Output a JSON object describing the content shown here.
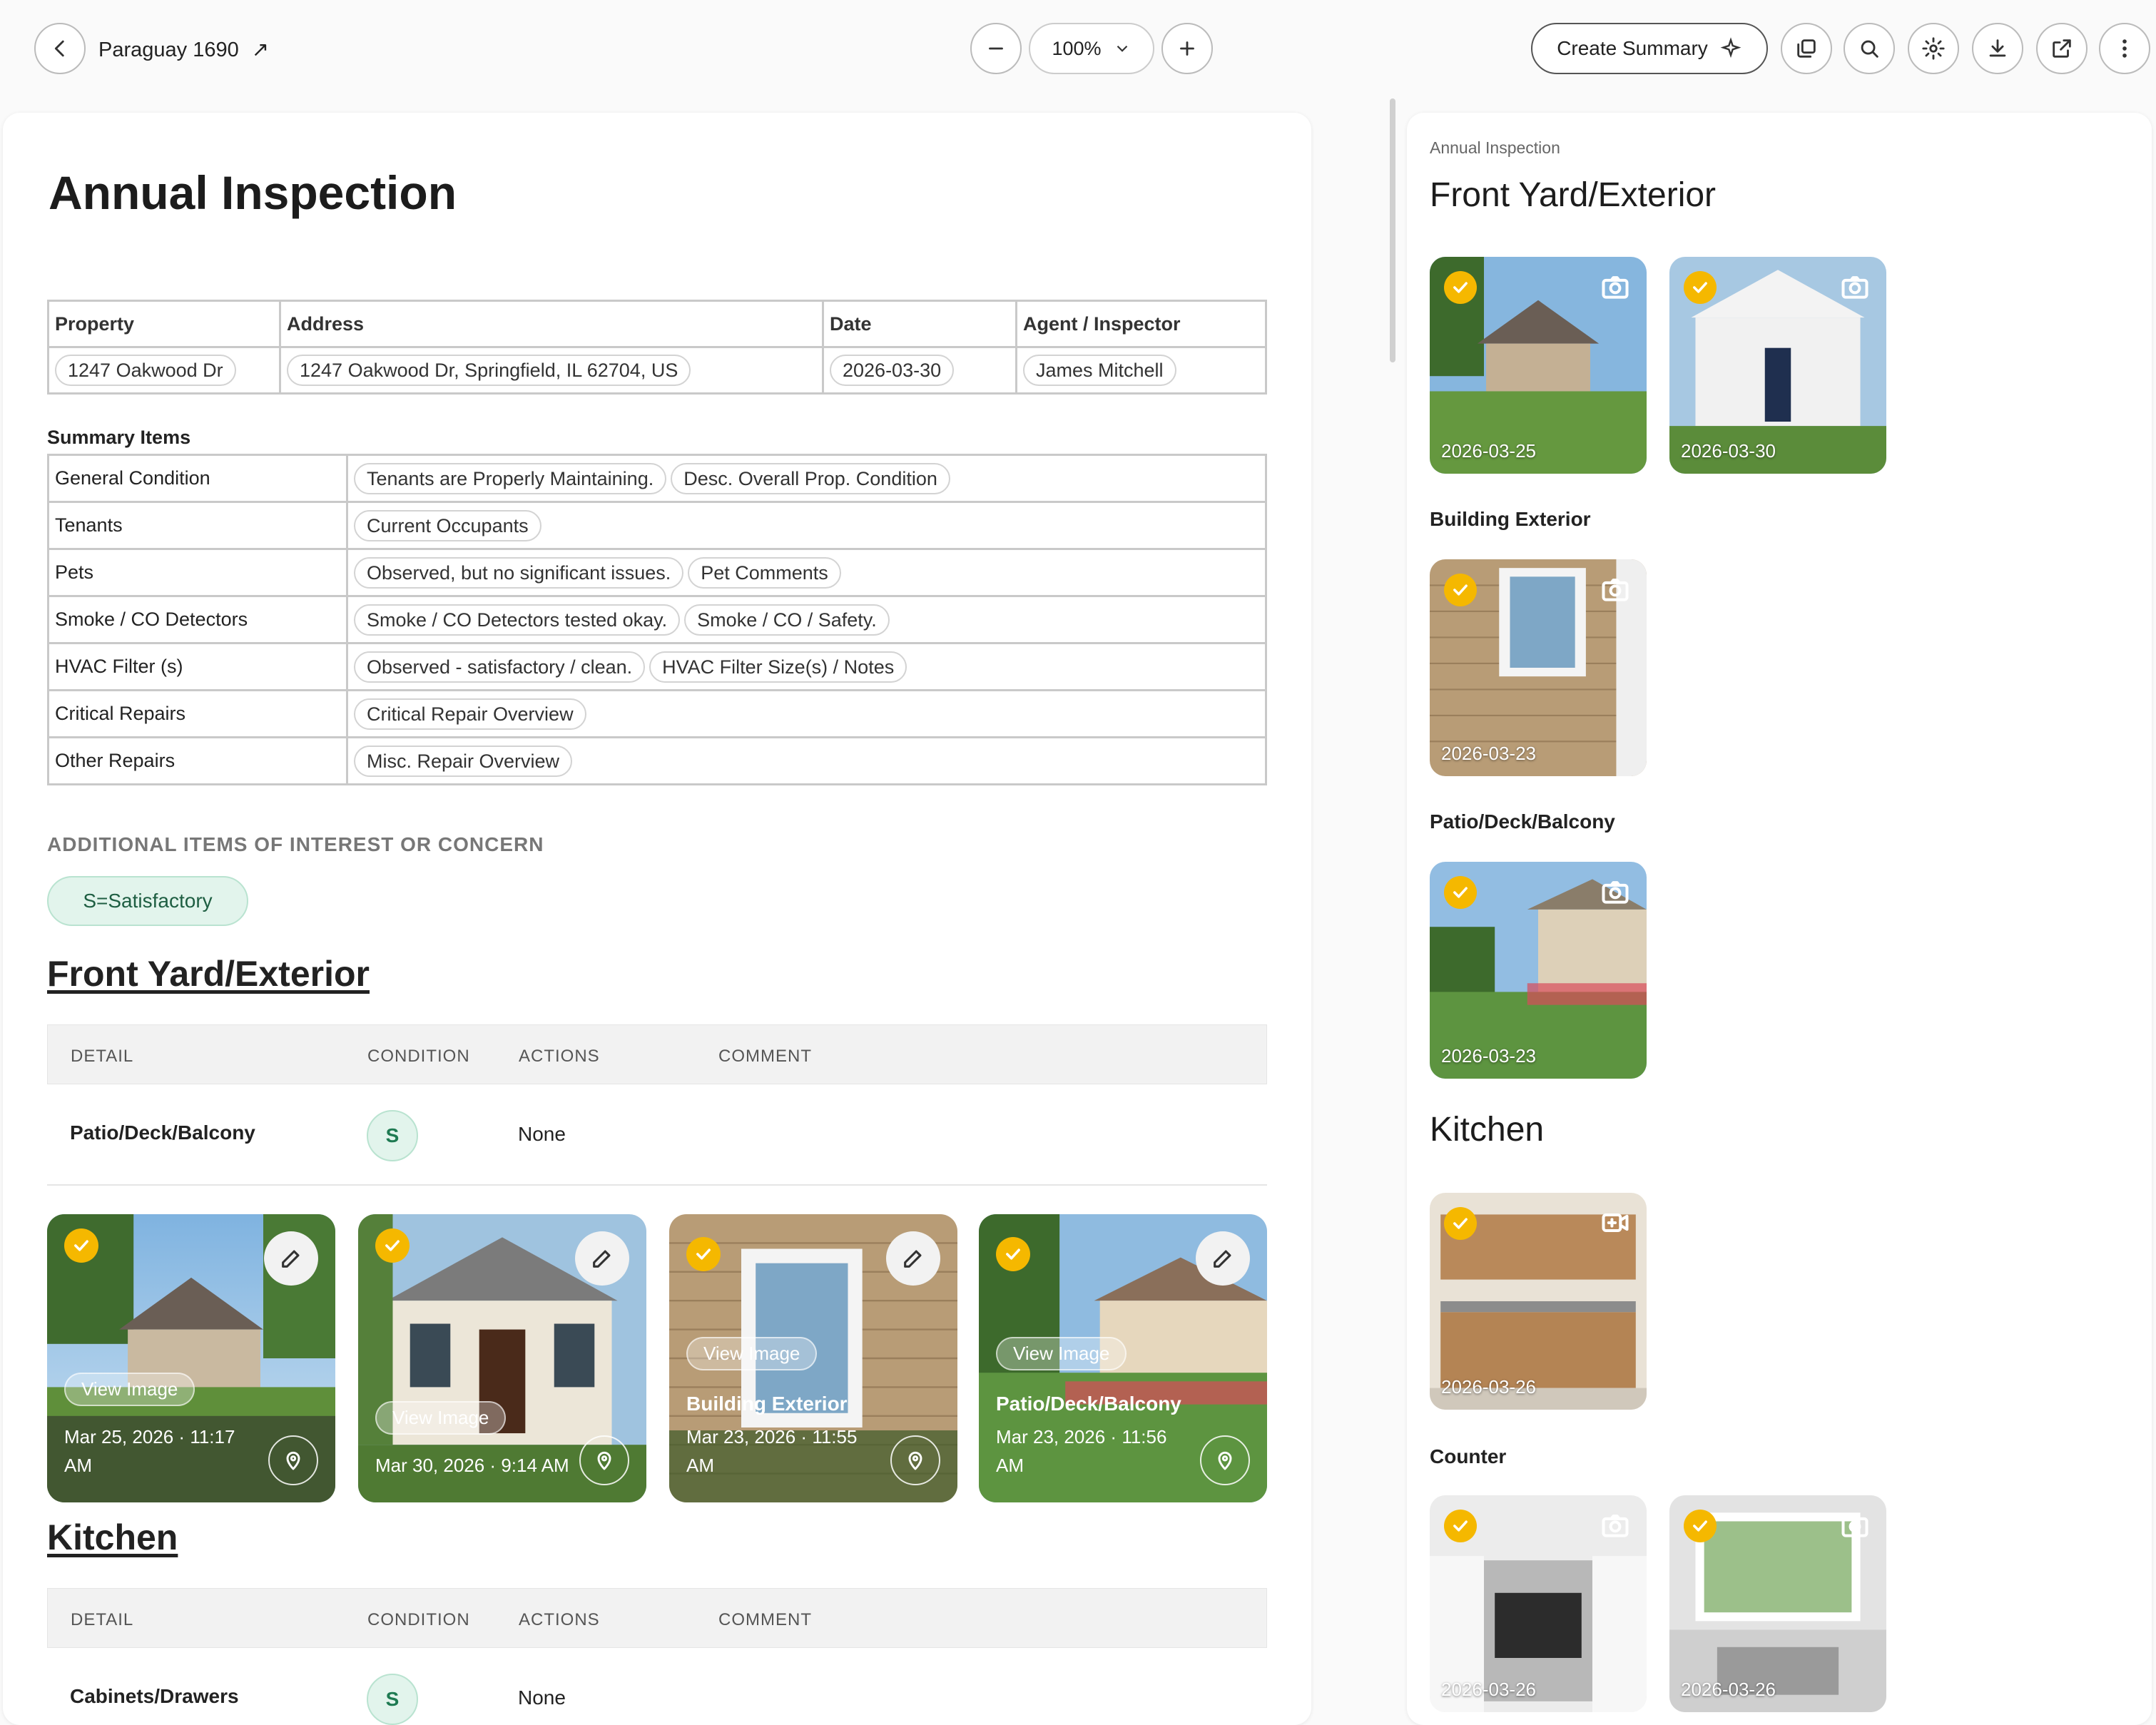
{
  "header": {
    "project_title": "Paraguay 1690",
    "zoom": "100%",
    "create_summary_label": "Create Summary"
  },
  "document": {
    "title": "Annual Inspection",
    "info_headers": [
      "Property",
      "Address",
      "Date",
      "Agent / Inspector"
    ],
    "info_values": [
      "1247 Oakwood Dr",
      "1247 Oakwood Dr, Springfield, IL 62704, US",
      "2026-03-30",
      "James Mitchell"
    ],
    "summary_title": "Summary Items",
    "summary_rows": [
      {
        "label": "General Condition",
        "pills": [
          "Tenants are Properly Maintaining.",
          "Desc. Overall Prop. Condition"
        ]
      },
      {
        "label": "Tenants",
        "pills": [
          "Current Occupants"
        ]
      },
      {
        "label": "Pets",
        "pills": [
          "Observed, but no significant issues.",
          "Pet Comments"
        ]
      },
      {
        "label": "Smoke / CO Detectors",
        "pills": [
          "Smoke / CO Detectors tested okay.",
          "Smoke / CO / Safety."
        ]
      },
      {
        "label": "HVAC Filter (s)",
        "pills": [
          "Observed - satisfactory / clean.",
          "HVAC Filter Size(s) / Notes"
        ]
      },
      {
        "label": "Critical Repairs",
        "pills": [
          "Critical Repair Overview"
        ]
      },
      {
        "label": "Other Repairs",
        "pills": [
          "Misc. Repair Overview"
        ]
      }
    ],
    "additional_title": "ADDITIONAL ITEMS OF INTEREST OR CONCERN",
    "legend_badge": "S=Satisfactory",
    "columns": [
      "DETAIL",
      "CONDITION",
      "ACTIONS",
      "COMMENT"
    ],
    "sections": [
      {
        "title": "Front Yard/Exterior",
        "row": {
          "detail": "Patio/Deck/Balcony",
          "condition": "S",
          "actions": "None"
        },
        "cards": [
          {
            "view": "View Image",
            "caption": "",
            "date_line1": "Mar 25, 2026 · 11:17",
            "date_line2": "AM"
          },
          {
            "view": "View Image",
            "caption": "",
            "date_line1": "Mar 30, 2026 · 9:14 AM",
            "date_line2": ""
          },
          {
            "view": "View Image",
            "caption": "Building Exterior",
            "date_line1": "Mar 23, 2026 · 11:55",
            "date_line2": "AM"
          },
          {
            "view": "View Image",
            "caption": "Patio/Deck/Balcony",
            "date_line1": "Mar 23, 2026 · 11:56",
            "date_line2": "AM"
          }
        ]
      },
      {
        "title": "Kitchen",
        "row": {
          "detail": "Cabinets/Drawers",
          "condition": "S",
          "actions": "None"
        }
      }
    ]
  },
  "right_panel": {
    "breadcrumb": "Annual Inspection",
    "section1_title": "Front Yard/Exterior",
    "s1_dates": [
      "2026-03-25",
      "2026-03-30"
    ],
    "building_exterior_label": "Building Exterior",
    "building_date": "2026-03-23",
    "patio_label": "Patio/Deck/Balcony",
    "patio_date": "2026-03-23",
    "section2_title": "Kitchen",
    "kitchen_date": "2026-03-26",
    "counter_label": "Counter",
    "counter_dates": [
      "2026-03-26",
      "2026-03-26"
    ]
  },
  "colors": {
    "accent_check": "#f5b800",
    "condition_green": "#1e7a52",
    "legend_bg": "#e2f4ec"
  }
}
